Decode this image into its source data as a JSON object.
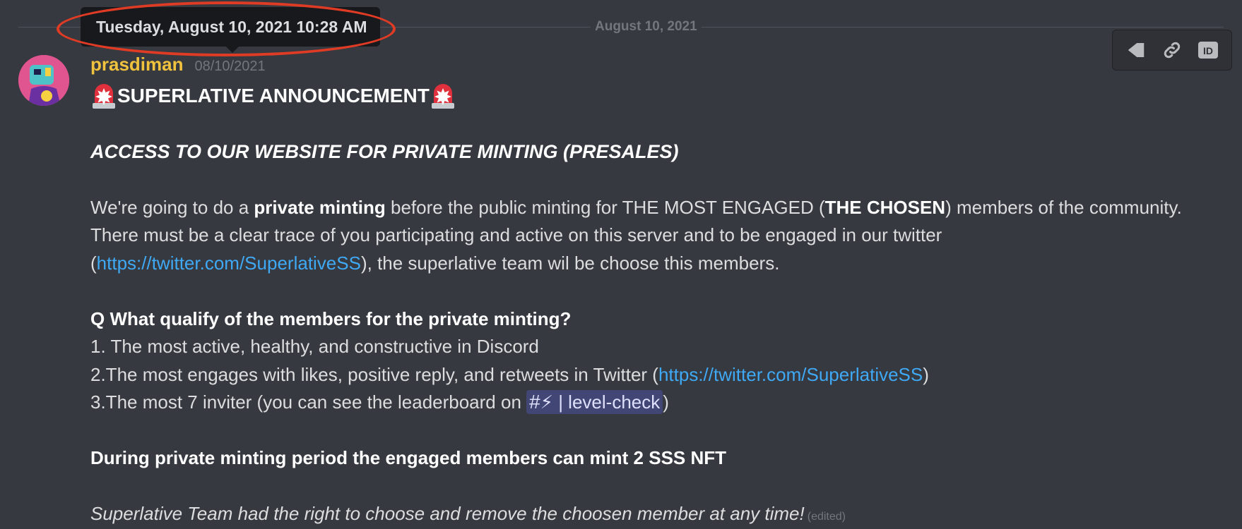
{
  "divider": {
    "date": "August 10, 2021"
  },
  "tooltip": {
    "text": "Tuesday, August 10, 2021 10:28 AM"
  },
  "toolbar": {
    "icons": [
      "pin-icon",
      "link-icon",
      "id-icon"
    ],
    "id_label": "ID"
  },
  "message": {
    "username": "prasdiman",
    "timestamp": "08/10/2021",
    "title": "SUPERLATIVE ANNOUNCEMENT",
    "access_heading": "ACCESS TO OUR WEBSITE FOR PRIVATE MINTING (PRESALES)",
    "p1": {
      "a": "We're going to do a ",
      "b_bold": "private minting",
      "c": " before the public minting for THE MOST ENGAGED (",
      "d_bold": "THE CHOSEN",
      "e": ") members of the community."
    },
    "p2": "There must be a clear trace of you participating and active on this server and to be engaged in our twitter",
    "p3": {
      "open": "(",
      "link": "https://twitter.com/SuperlativeSS",
      "rest": "), the superlative team wil be choose this members."
    },
    "q_heading": "Q What qualify of the members for the private minting?",
    "item1": "1. The most active, healthy, and constructive in Discord",
    "item2": {
      "text": "2.The most engages with likes, positive reply, and retweets in Twitter (",
      "link": "https://twitter.com/SuperlativeSS",
      "close": ")"
    },
    "item3": {
      "text": "3.The most 7 inviter (you can see the leaderboard on ",
      "channel_hash": "#",
      "channel_emoji": "⚡",
      "channel_name": " | level-check",
      "close": ")"
    },
    "private_period": "During private minting period the engaged members can mint 2 SSS NFT",
    "footer": "Superlative Team had the right to choose and remove the choosen member at any time!",
    "edited": "(edited)"
  },
  "colors": {
    "background": "#36393f",
    "username": "#f0c23e",
    "link": "#3fa9f5",
    "mention_bg": "#414675",
    "tooltip_bg": "#18191c",
    "highlight": "#e03b24"
  }
}
